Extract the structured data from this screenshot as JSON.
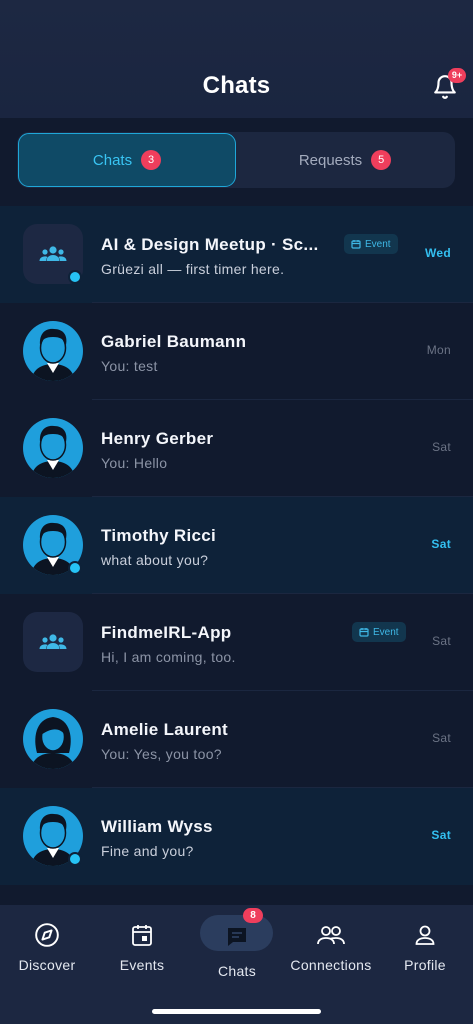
{
  "header": {
    "title": "Chats",
    "notification_badge": "9+"
  },
  "tabs": [
    {
      "label": "Chats",
      "badge": "3",
      "active": true
    },
    {
      "label": "Requests",
      "badge": "5",
      "active": false
    }
  ],
  "chats": [
    {
      "name": "AI & Design Meetup · Sc...",
      "preview": "Grüezi all — first timer here.",
      "time": "Wed",
      "tag": "Event",
      "unread": true,
      "avatar": "group-icon"
    },
    {
      "name": "Gabriel Baumann",
      "preview": "You: test",
      "time": "Mon",
      "unread": false,
      "avatar": "male-avatar"
    },
    {
      "name": "Henry Gerber",
      "preview": "You: Hello",
      "time": "Sat",
      "unread": false,
      "avatar": "male-avatar"
    },
    {
      "name": "Timothy Ricci",
      "preview": "what about you?",
      "time": "Sat",
      "unread": true,
      "avatar": "male-avatar"
    },
    {
      "name": "FindmeIRL-App",
      "preview": "Hi, I am coming, too.",
      "time": "Sat",
      "tag": "Event",
      "unread": false,
      "avatar": "group-icon"
    },
    {
      "name": "Amelie Laurent",
      "preview": "You: Yes, you too?",
      "time": "Sat",
      "unread": false,
      "avatar": "female-avatar"
    },
    {
      "name": "William Wyss",
      "preview": "Fine and you?",
      "time": "Sat",
      "unread": true,
      "avatar": "male-avatar"
    }
  ],
  "nav": {
    "discover": "Discover",
    "events": "Events",
    "chats": "Chats",
    "chats_badge": "8",
    "connections": "Connections",
    "profile": "Profile"
  },
  "colors": {
    "accent": "#33bff0",
    "badge": "#ef3e5c",
    "background": "#111a2e"
  }
}
